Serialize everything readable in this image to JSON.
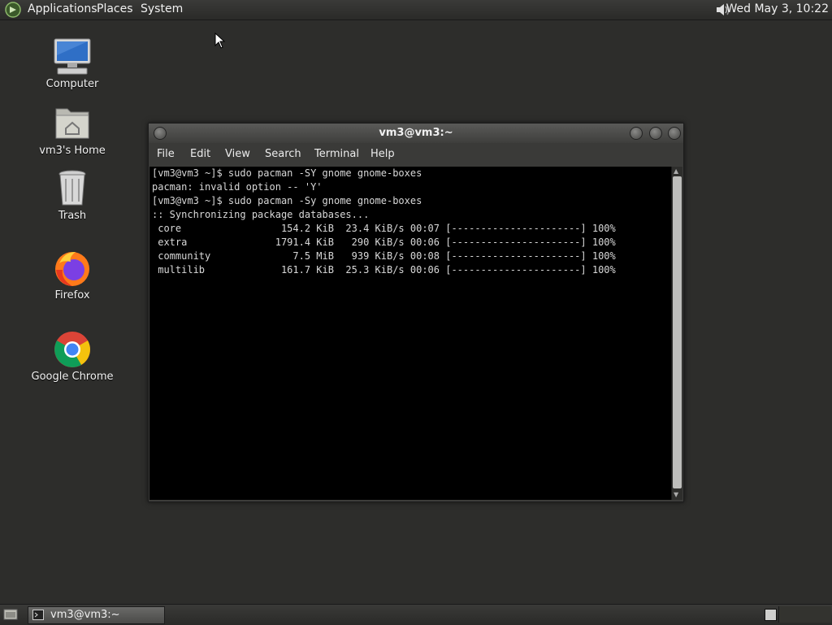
{
  "top_panel": {
    "menus": [
      "Applications",
      "Places",
      "System"
    ],
    "clock": "Wed May  3, 10:22",
    "logo_icon": "mint-logo-icon",
    "volume_icon": "speaker-icon"
  },
  "desktop": {
    "icons": [
      {
        "label": "Computer",
        "icon": "computer-icon"
      },
      {
        "label": "vm3's Home",
        "icon": "home-folder-icon"
      },
      {
        "label": "Trash",
        "icon": "trash-icon"
      },
      {
        "label": "Firefox",
        "icon": "firefox-icon"
      },
      {
        "label": "Google Chrome",
        "icon": "chrome-icon"
      }
    ]
  },
  "terminal": {
    "title": "vm3@vm3:~",
    "menus": [
      "File",
      "Edit",
      "View",
      "Search",
      "Terminal",
      "Help"
    ],
    "lines": [
      "[vm3@vm3 ~]$ sudo pacman -SY gnome gnome-boxes",
      "pacman: invalid option -- 'Y'",
      "[vm3@vm3 ~]$ sudo pacman -Sy gnome gnome-boxes",
      ":: Synchronizing package databases...",
      " core                 154.2 KiB  23.4 KiB/s 00:07 [----------------------] 100%",
      " extra               1791.4 KiB   290 KiB/s 00:06 [----------------------] 100%",
      " community              7.5 MiB   939 KiB/s 00:08 [----------------------] 100%",
      " multilib             161.7 KiB  25.3 KiB/s 00:06 [----------------------] 100%"
    ]
  },
  "taskbar": {
    "window_button": "vm3@vm3:~",
    "show_desktop_icon": "show-desktop-icon",
    "terminal_icon": "terminal-icon"
  },
  "colors": {
    "desktop_bg": "#2d2d2b",
    "terminal_bg": "#000000",
    "terminal_fg": "#d8d8d8"
  }
}
